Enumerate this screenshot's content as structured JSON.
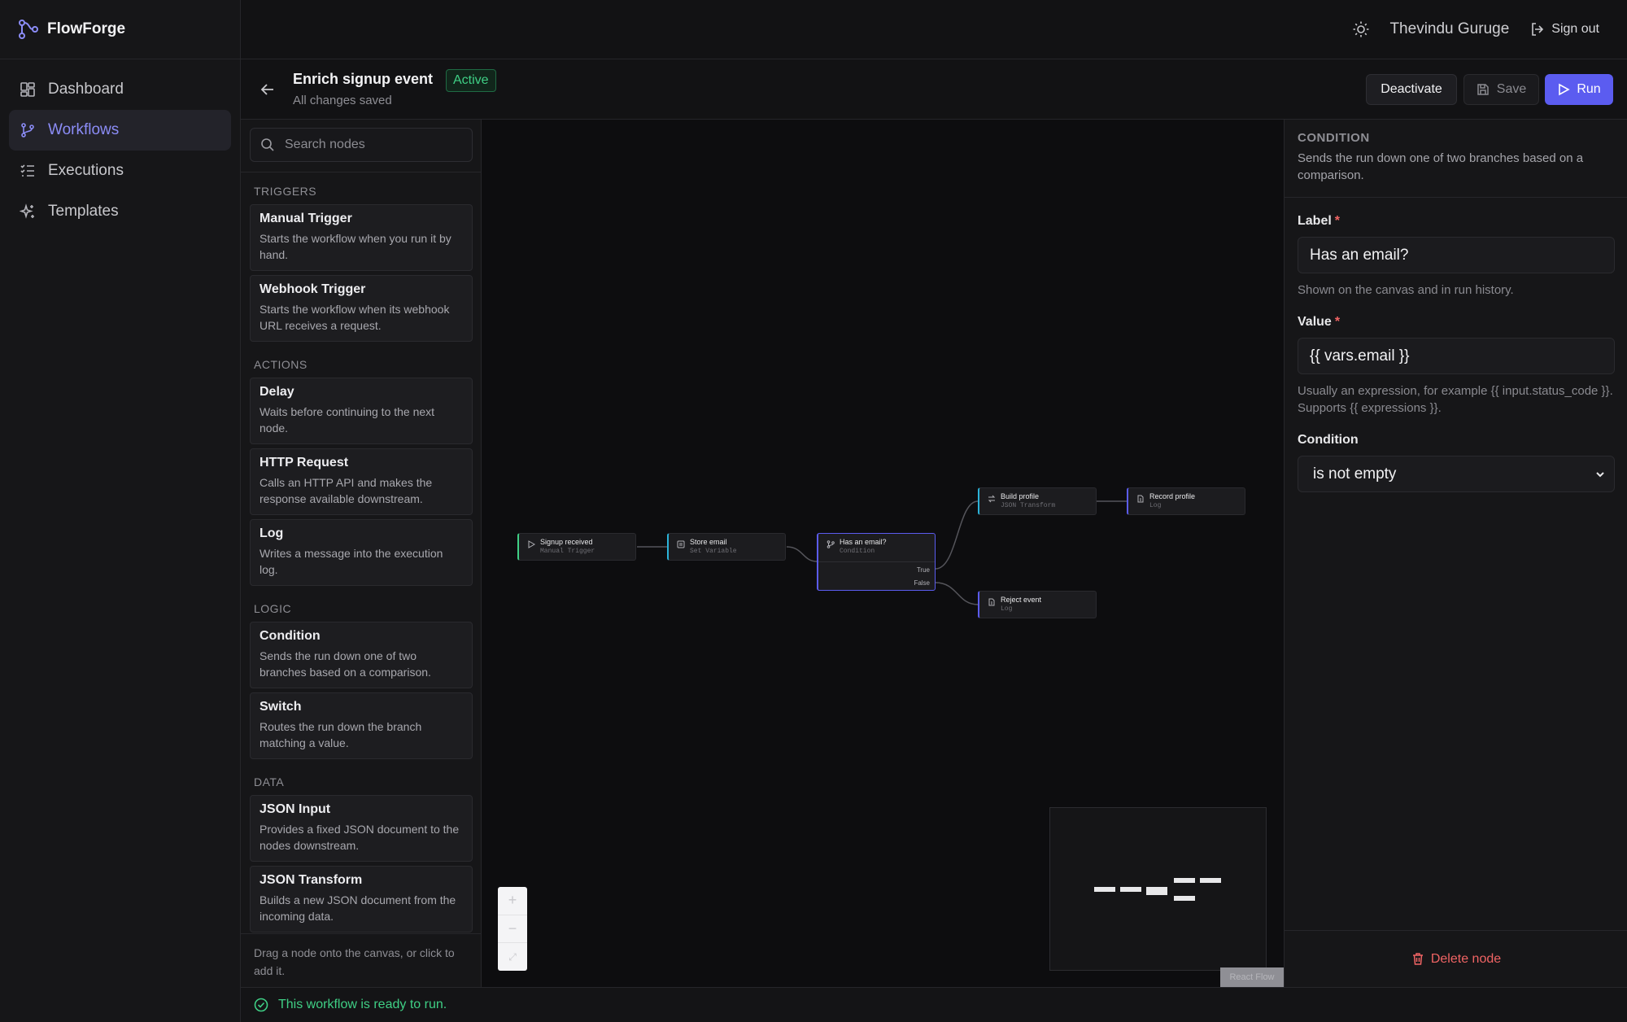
{
  "app": {
    "name": "FlowForge"
  },
  "sidebar": {
    "items": [
      {
        "label": "Dashboard",
        "icon": "dashboard-icon"
      },
      {
        "label": "Workflows",
        "icon": "workflow-icon",
        "active": true
      },
      {
        "label": "Executions",
        "icon": "list-checks-icon"
      },
      {
        "label": "Templates",
        "icon": "sparkles-icon"
      }
    ]
  },
  "topbar": {
    "user_name": "Thevindu Guruge",
    "sign_out": "Sign out"
  },
  "workflow": {
    "title": "Enrich signup event",
    "status": "Active",
    "save_state": "All changes saved",
    "buttons": {
      "deactivate": "Deactivate",
      "save": "Save",
      "run": "Run"
    }
  },
  "palette": {
    "search_placeholder": "Search nodes",
    "sections": [
      {
        "title": "TRIGGERS",
        "nodes": [
          {
            "title": "Manual Trigger",
            "desc": "Starts the workflow when you run it by hand."
          },
          {
            "title": "Webhook Trigger",
            "desc": "Starts the workflow when its webhook URL receives a request."
          }
        ]
      },
      {
        "title": "ACTIONS",
        "nodes": [
          {
            "title": "Delay",
            "desc": "Waits before continuing to the next node."
          },
          {
            "title": "HTTP Request",
            "desc": "Calls an HTTP API and makes the response available downstream."
          },
          {
            "title": "Log",
            "desc": "Writes a message into the execution log."
          }
        ]
      },
      {
        "title": "LOGIC",
        "nodes": [
          {
            "title": "Condition",
            "desc": "Sends the run down one of two branches based on a comparison."
          },
          {
            "title": "Switch",
            "desc": "Routes the run down the branch matching a value."
          }
        ]
      },
      {
        "title": "DATA",
        "nodes": [
          {
            "title": "JSON Input",
            "desc": "Provides a fixed JSON document to the nodes downstream."
          },
          {
            "title": "JSON Transform",
            "desc": "Builds a new JSON document from the incoming data."
          }
        ]
      }
    ],
    "footer": "Drag a node onto the canvas, or click to add it."
  },
  "canvas": {
    "nodes": [
      {
        "title": "Signup received",
        "type": "Manual Trigger",
        "accent": "#3fcf85"
      },
      {
        "title": "Store email",
        "type": "Set Variable",
        "accent": "#2bb3d9"
      },
      {
        "title": "Has an email?",
        "type": "Condition",
        "accent": "#5b5cf0",
        "ports": [
          "True",
          "False"
        ]
      },
      {
        "title": "Build profile",
        "type": "JSON Transform",
        "accent": "#2bb3d9"
      },
      {
        "title": "Record profile",
        "type": "Log",
        "accent": "#5b5cf0"
      },
      {
        "title": "Reject event",
        "type": "Log",
        "accent": "#5b5cf0"
      }
    ],
    "attribution": "React Flow"
  },
  "properties": {
    "kind": "CONDITION",
    "description": "Sends the run down one of two branches based on a comparison.",
    "label_field": {
      "label": "Label",
      "value": "Has an email?",
      "hint": "Shown on the canvas and in run history."
    },
    "value_field": {
      "label": "Value",
      "value": "{{ vars.email }}",
      "hint": "Usually an expression, for example {{ input.status_code }}. Supports {{ expressions }}."
    },
    "condition_field": {
      "label": "Condition",
      "value": "is not empty"
    },
    "delete": "Delete node"
  },
  "status": {
    "message": "This workflow is ready to run."
  },
  "colors": {
    "accent": "#5b5cf0",
    "success": "#3fcf85",
    "danger": "#f06464"
  }
}
